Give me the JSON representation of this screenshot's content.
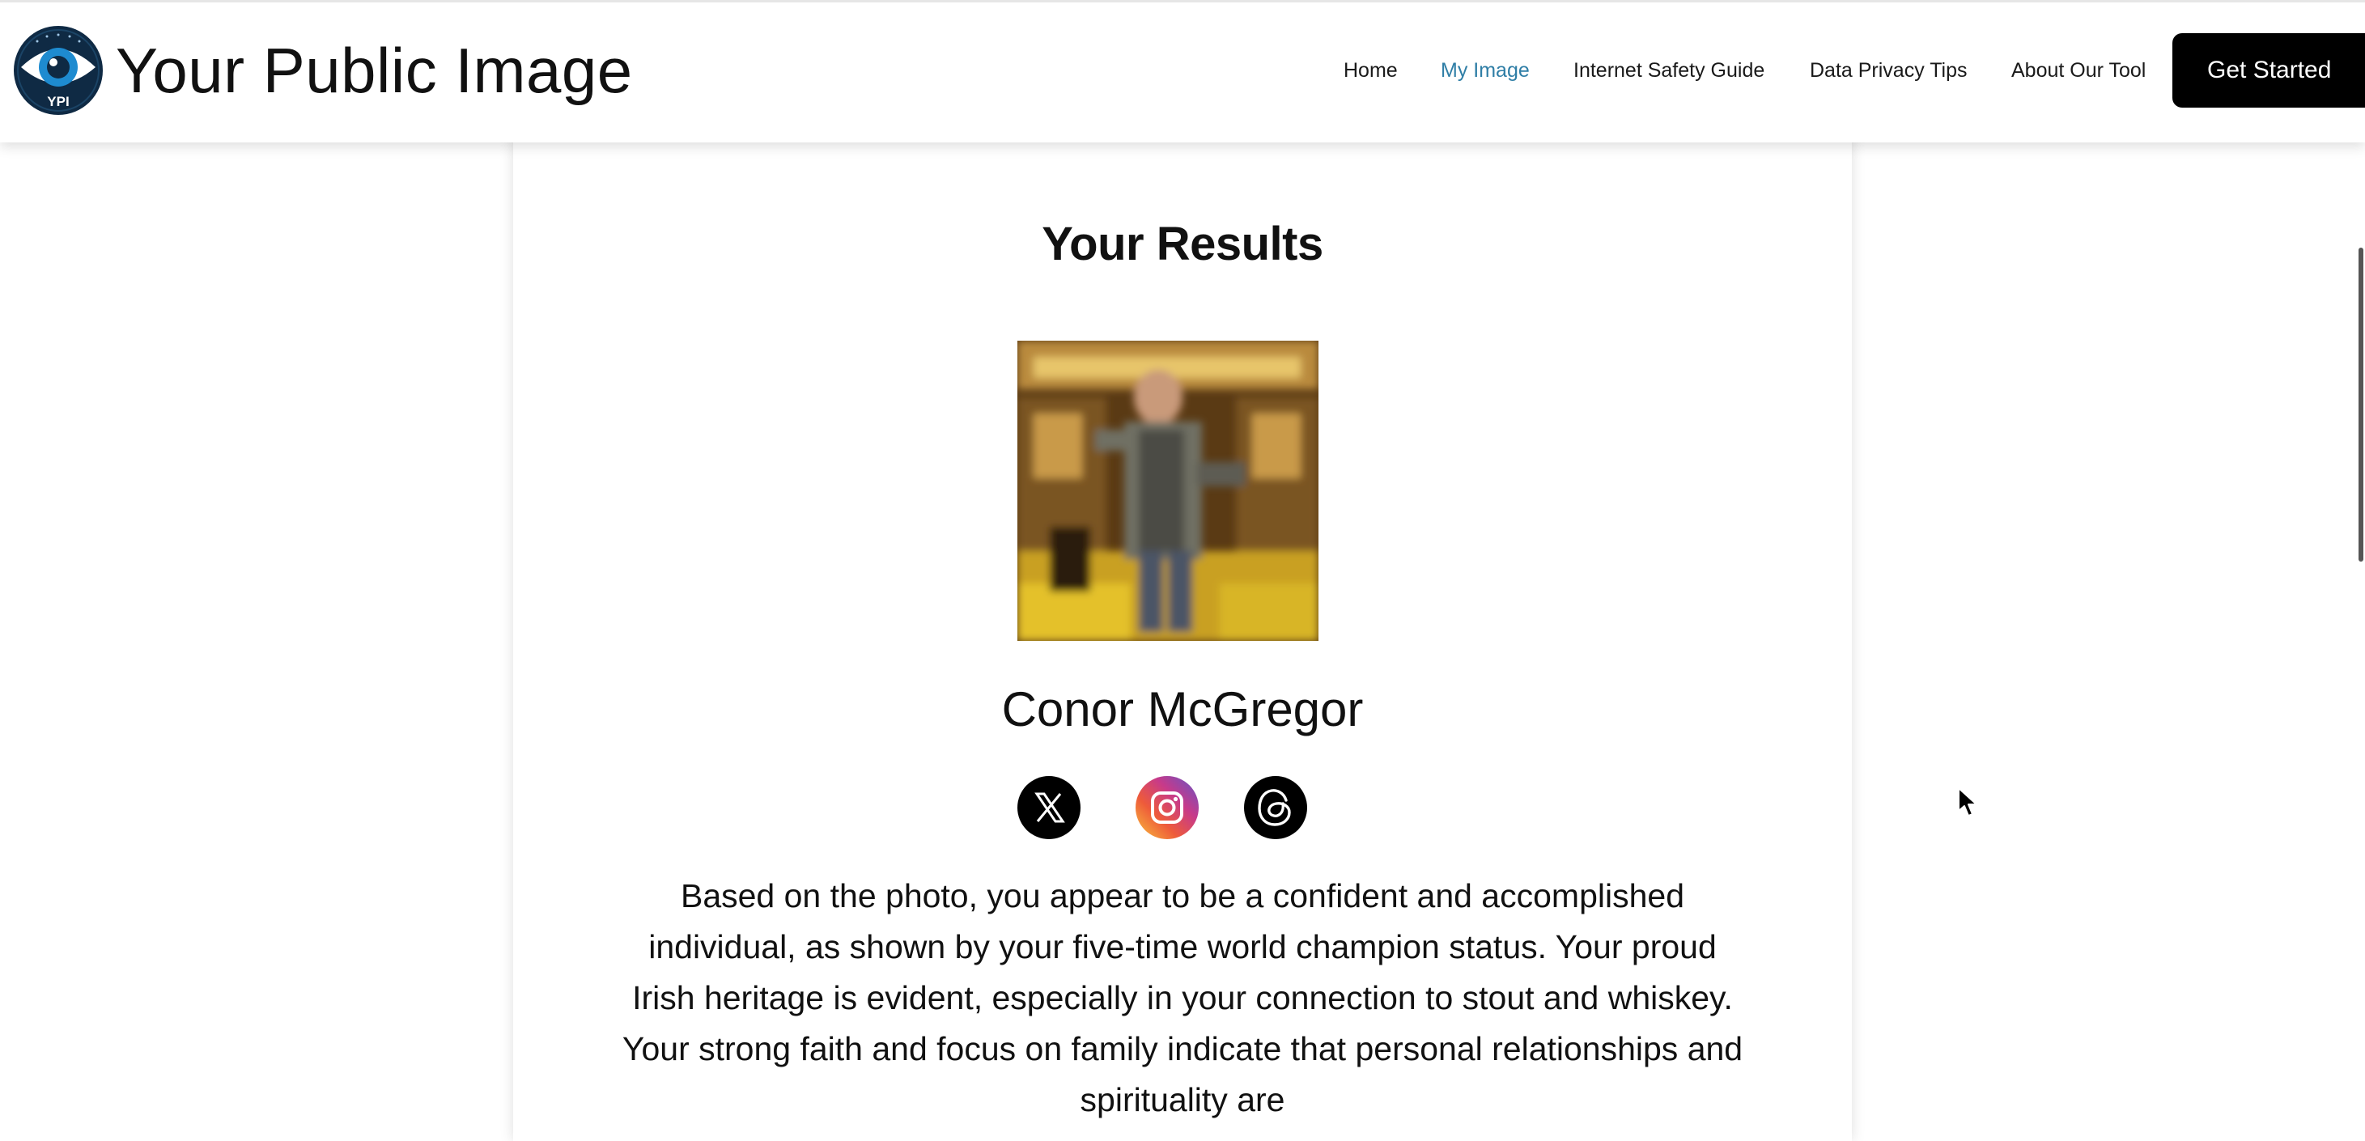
{
  "header": {
    "logo_text": "YPI",
    "site_title": "Your Public Image",
    "nav": [
      {
        "label": "Home",
        "active": false
      },
      {
        "label": "My Image",
        "active": true
      },
      {
        "label": "Internet Safety Guide",
        "active": false
      },
      {
        "label": "Data Privacy Tips",
        "active": false
      },
      {
        "label": "About Our Tool",
        "active": false
      }
    ],
    "cta_label": "Get Started"
  },
  "results": {
    "title": "Your Results",
    "photo_icon": "profile-photo",
    "name": "Conor McGregor",
    "socials": [
      {
        "name": "x",
        "icon": "x-icon"
      },
      {
        "name": "instagram",
        "icon": "instagram-icon"
      },
      {
        "name": "threads",
        "icon": "threads-icon"
      }
    ],
    "bio": "Based on the photo, you appear to be a confident and accomplished individual, as shown by your five-time world champion status. Your proud Irish heritage is evident, especially in your connection to stout and whiskey. Your strong faith and focus on family indicate that personal relationships and spirituality are"
  },
  "colors": {
    "accent_nav": "#2f7ea6",
    "cta_bg": "#000000",
    "logo_dark": "#0f2a44",
    "logo_blue": "#1e8bd0"
  }
}
